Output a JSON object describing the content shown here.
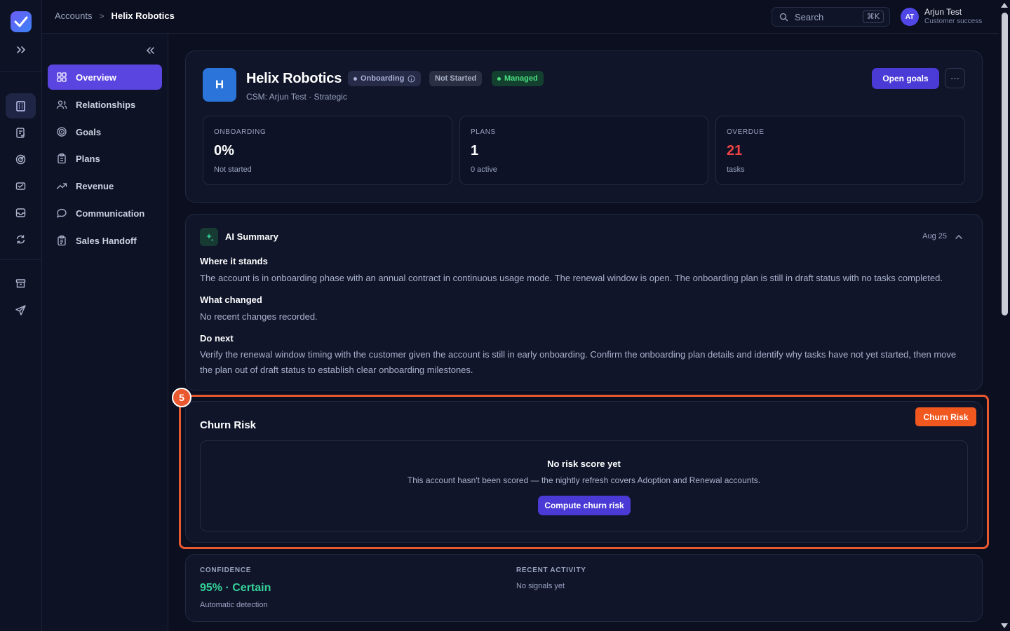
{
  "breadcrumb": {
    "parent": "Accounts",
    "separator": ">",
    "current": "Helix Robotics"
  },
  "search": {
    "label": "Search",
    "shortcut": "⌘K"
  },
  "user": {
    "initials": "AT",
    "name": "Arjun Test",
    "role": "Customer success"
  },
  "sidebar": {
    "items": [
      {
        "label": "Overview",
        "icon": "grid-icon",
        "active": true
      },
      {
        "label": "Relationships",
        "icon": "users-icon"
      },
      {
        "label": "Goals",
        "icon": "target-icon"
      },
      {
        "label": "Plans",
        "icon": "clipboard-icon"
      },
      {
        "label": "Revenue",
        "icon": "trend-icon"
      },
      {
        "label": "Communication",
        "icon": "chat-icon"
      },
      {
        "label": "Sales Handoff",
        "icon": "clipboard-list-icon"
      }
    ]
  },
  "account": {
    "initial": "H",
    "name": "Helix Robotics",
    "subtitle": "CSM: Arjun Test · Strategic",
    "badges": {
      "phase": "Onboarding",
      "status": "Not Started",
      "managed": "Managed"
    },
    "open_goals_label": "Open goals",
    "more_label": "···",
    "stats": [
      {
        "label": "ONBOARDING",
        "value": "0%",
        "note": "Not started",
        "color": "#ffffff"
      },
      {
        "label": "PLANS",
        "value": "1",
        "note": "0 active",
        "color": "#ffffff"
      },
      {
        "label": "OVERDUE",
        "value": "21",
        "note": "tasks",
        "color": "#ef4444"
      }
    ]
  },
  "ai_summary": {
    "title": "AI Summary",
    "date": "Aug 25",
    "sections": [
      {
        "heading": "Where it stands",
        "body": "The account is in onboarding phase with an annual contract in continuous usage mode. The renewal window is open. The onboarding plan is still in draft status with no tasks completed."
      },
      {
        "heading": "What changed",
        "body": "No recent changes recorded."
      },
      {
        "heading": "Do next",
        "body": "Verify the renewal window timing with the customer given the account is still in early onboarding. Confirm the onboarding plan details and identify why tasks have not yet started, then move the plan out of draft status to establish clear onboarding milestones."
      }
    ]
  },
  "churn": {
    "title": "Churn Risk",
    "marker": "5",
    "tag": "Churn Risk",
    "empty_title": "No risk score yet",
    "empty_body": "This account hasn't been scored — the nightly refresh covers Adoption and Renewal accounts.",
    "button": "Compute churn risk"
  },
  "detection": {
    "confidence_label": "CONFIDENCE",
    "confidence_value": "95% · Certain",
    "confidence_note": "Automatic detection",
    "recent_label": "RECENT ACTIVITY",
    "recent_note": "No signals yet"
  },
  "colors": {
    "accent": "#5b45e0",
    "danger": "#ef4444",
    "success": "#34d399",
    "highlight": "#e9582f"
  }
}
